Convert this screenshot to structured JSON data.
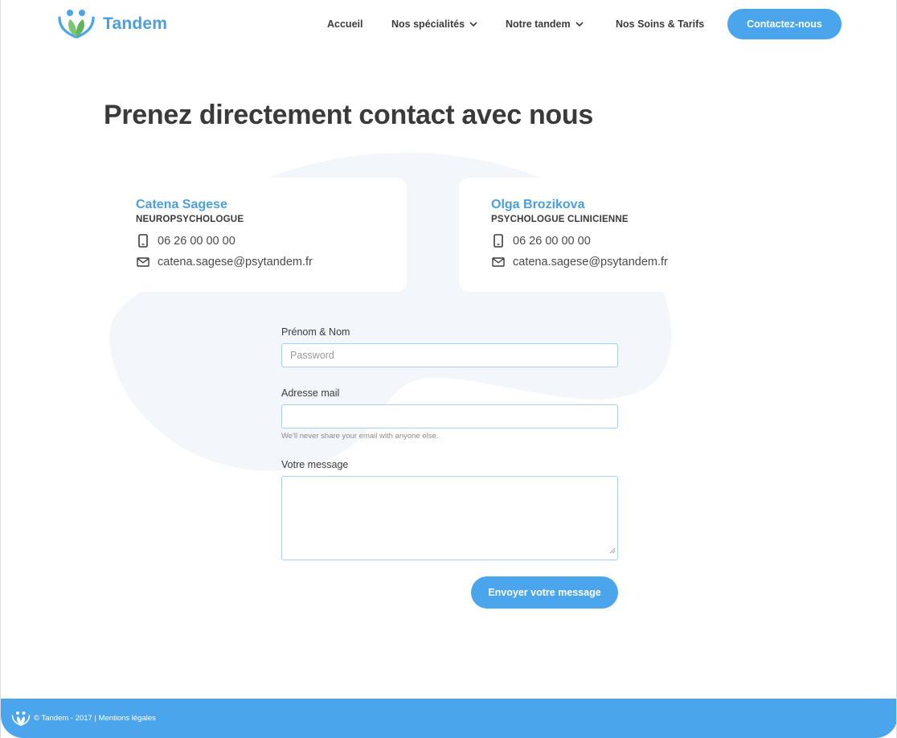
{
  "brand": {
    "name": "Tandem",
    "accent_color": "#4aa5ec",
    "logo_icon": "tandem-logo-icon"
  },
  "nav": {
    "items": [
      {
        "label": "Accueil",
        "has_dropdown": false
      },
      {
        "label": "Nos spécialités",
        "has_dropdown": true
      },
      {
        "label": "Notre tandem",
        "has_dropdown": true
      },
      {
        "label": "Nos Soins & Tarifs",
        "has_dropdown": false
      }
    ],
    "cta_label": "Contactez-nous"
  },
  "page": {
    "title": "Prenez directement contact avec nous"
  },
  "contacts": [
    {
      "name": "Catena Sagese",
      "role": "NEUROPSYCHOLOGUE",
      "phone": "06 26 00 00  00",
      "email": "catena.sagese@psytandem.fr",
      "phone_icon": "mobile-phone-icon",
      "email_icon": "envelope-icon"
    },
    {
      "name": "Olga Brozikova",
      "role": "PSYCHOLOGUE CLINICIENNE",
      "phone": "06 26 00 00  00",
      "email": "catena.sagese@psytandem.fr",
      "phone_icon": "mobile-phone-icon",
      "email_icon": "envelope-icon"
    }
  ],
  "form": {
    "name_label": "Prénom & Nom",
    "name_placeholder": "Password",
    "name_value": "",
    "email_label": "Adresse mail",
    "email_value": "",
    "email_help": "We'll never share your email with anyone else.",
    "message_label": "Votre message",
    "message_value": "",
    "submit_label": "Envoyer votre message"
  },
  "footer": {
    "copyright": "© Tandem - 2017 | ",
    "legal_link": "Mentions légales"
  }
}
